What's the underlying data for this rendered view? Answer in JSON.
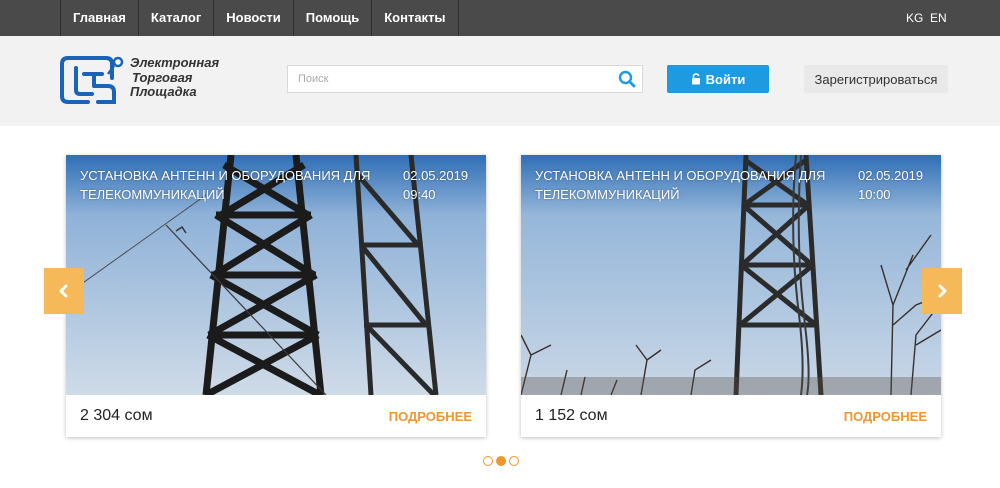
{
  "nav": {
    "items": [
      "Главная",
      "Каталог",
      "Новости",
      "Помощь",
      "Контакты"
    ],
    "langs": [
      "KG",
      "EN"
    ]
  },
  "header": {
    "logo_lines": [
      "Электронная",
      "Торговая",
      "Площадка"
    ],
    "search_placeholder": "Поиск",
    "login_label": "Войти",
    "register_label": "Зарегистрироваться"
  },
  "cards": [
    {
      "title": "УСТАНОВКА АНТЕНН И ОБОРУДОВАНИЯ ДЛЯ ТЕЛЕКОММУНИКАЦИЙ",
      "date": "02.05.2019",
      "time": "09:40",
      "price": "2 304 сом",
      "more": "ПОДРОБНЕЕ"
    },
    {
      "title": "УСТАНОВКА АНТЕНН И ОБОРУДОВАНИЯ ДЛЯ ТЕЛЕКОММУНИКАЦИЙ",
      "date": "02.05.2019",
      "time": "10:00",
      "price": "1 152 сом",
      "more": "ПОДРОБНЕЕ"
    }
  ],
  "carousel": {
    "pages": 3,
    "active_page": 2
  },
  "colors": {
    "topbar": "#4a4a4a",
    "header_bg": "#f2f2f2",
    "accent_blue": "#1e9be0",
    "accent_orange": "#f0962e",
    "arrow_bg": "#f5b95a"
  },
  "icons": {
    "search": "search-icon",
    "login": "lock-icon",
    "prev": "chevron-left-icon",
    "next": "chevron-right-icon"
  }
}
